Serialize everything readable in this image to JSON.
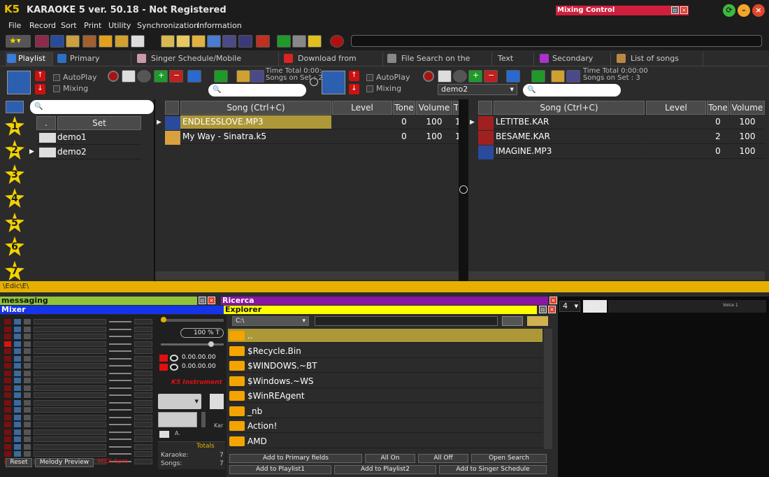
{
  "app": {
    "logo": "K5",
    "title": "KARAOKE 5   ver. 50.18 - Not Registered",
    "mixing_control": "Mixing Control"
  },
  "menu": [
    "File",
    "Record",
    "Sort",
    "Print",
    "Utility",
    "Synchronization",
    "Information"
  ],
  "tabs": [
    {
      "label": "Playlist",
      "icon": "playlist-icon",
      "color": "#3a7bd5"
    },
    {
      "label": "Primary Database",
      "icon": "database-icon",
      "color": "#2d6fc6"
    },
    {
      "label": "Singer Schedule/Mobile Management",
      "icon": "singer-icon",
      "color": "#c9a"
    },
    {
      "label": "Download from Youtube",
      "icon": "youtube-icon",
      "color": "#d22"
    },
    {
      "label": "File Search on the Internet",
      "icon": "web-search-icon",
      "color": "#888"
    },
    {
      "label": "Text song",
      "icon": "",
      "color": ""
    },
    {
      "label": "Secondary fields",
      "icon": "fields-icon",
      "color": "#a3c"
    },
    {
      "label": "List of songs played",
      "icon": "list-icon",
      "color": "#b84"
    }
  ],
  "controls": {
    "autoplay": "AutoPlay",
    "mixing": "Mixing",
    "left_time": "Time Total  0:00:",
    "left_songs": "Songs on Set : 2",
    "right_time": "Time Total  0:00:00",
    "right_songs": "Songs on Set : 3",
    "right_set_select": "demo2"
  },
  "sets": {
    "col_dot": ".",
    "col_set": "Set",
    "items": [
      "demo1",
      "demo2"
    ]
  },
  "stars": [
    "1",
    "2",
    "3",
    "4",
    "5",
    "6",
    "7"
  ],
  "left_playlist": {
    "headers": [
      "Song (Ctrl+C)",
      "Level",
      "Tone",
      "Volume",
      "T"
    ],
    "rows": [
      {
        "song": "ENDLESSLOVE.MP3",
        "level": "",
        "tone": "0",
        "volume": "100",
        "extra": "1"
      },
      {
        "song": "My Way - Sinatra.k5",
        "level": "",
        "tone": "0",
        "volume": "100",
        "extra": "1"
      }
    ]
  },
  "right_playlist": {
    "headers": [
      "Song (Ctrl+C)",
      "Level",
      "Tone",
      "Volume"
    ],
    "rows": [
      {
        "song": "LETITBE.KAR",
        "level": "",
        "tone": "0",
        "volume": "100"
      },
      {
        "song": "BESAME.KAR",
        "level": "",
        "tone": "2",
        "volume": "100"
      },
      {
        "song": "IMAGINE.MP3",
        "level": "",
        "tone": "0",
        "volume": "100"
      }
    ]
  },
  "path": "\\Edic\\E\\",
  "panels": {
    "messaging": "messaging",
    "ricerca": "Ricerca",
    "mixer": "Mixer",
    "explorer": "Explorer"
  },
  "mixer": {
    "pct": "100",
    "pct_unit": "% T",
    "time1": "0.00.00.00",
    "time2": "0.00.00.00",
    "instrument": "K5 Instrument",
    "kar": "Kar",
    "a": "A.",
    "totals": "Totals",
    "karaoke_label": "Karaoke:",
    "karaoke_val": "7",
    "songs_label": "Songs:",
    "songs_val": "7",
    "reset": "Reset",
    "melody": "Melody Preview",
    "midi": "MIDI 6pm"
  },
  "explorer": {
    "drive": "C:\\",
    "items": [
      "..",
      "$Recycle.Bin",
      "$WINDOWS.~BT",
      "$Windows.~WS",
      "$WinREAgent",
      "_nb",
      "Action!",
      "AMD"
    ],
    "buttons": [
      "Add to Primary fields",
      "All On",
      "All Off",
      "Open Search",
      "Add to Playlist1",
      "Add to Playlist2",
      "Add to Singer Schedule"
    ]
  },
  "right_panel": {
    "select": "4",
    "voice": "Voice 1"
  },
  "toolbar_icons": [
    "favorites-icon",
    "music-note-icon",
    "music-note-blue-icon",
    "film-icon",
    "tools-icon",
    "puzzle-icon",
    "camera-icon",
    "folder-icon",
    "search-icon",
    "globe-icon",
    "web-icon",
    "record-icon",
    "calendar-icon",
    "play-icon",
    "stop-icon",
    "pause-icon",
    "record-red-icon"
  ]
}
